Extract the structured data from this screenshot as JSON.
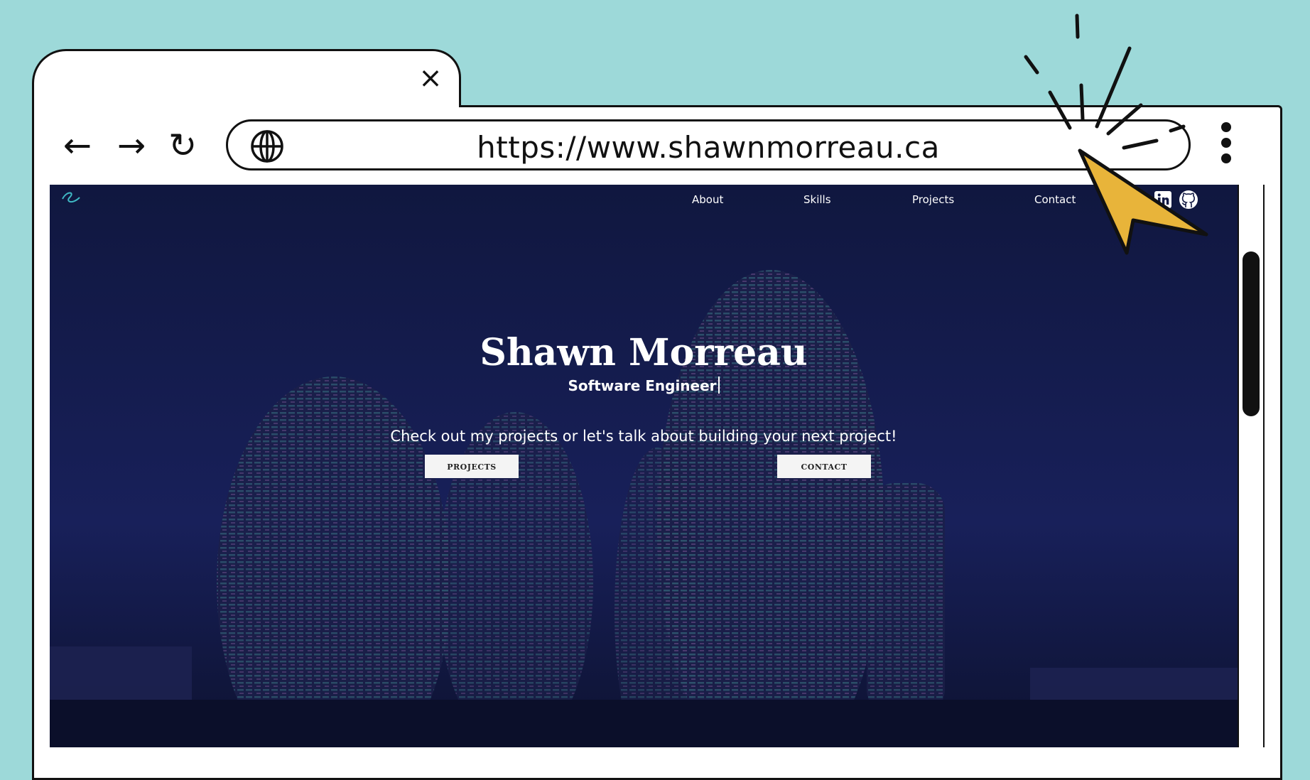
{
  "browser": {
    "tab_close_glyph": "×",
    "back_glyph": "←",
    "forward_glyph": "→",
    "reload_glyph": "↻",
    "url": "https://www.shawnmorreau.ca",
    "icons": [
      "globe-icon",
      "close-icon",
      "back-arrow-icon",
      "forward-arrow-icon",
      "reload-icon",
      "kebab-menu-icon",
      "cursor-pointer-icon"
    ]
  },
  "site": {
    "nav": {
      "about": "About",
      "skills": "Skills",
      "projects": "Projects",
      "contact": "Contact"
    },
    "social_icons": [
      "linkedin-icon",
      "github-icon"
    ],
    "hero": {
      "title": "Shawn Morreau",
      "subtitle": "Software Engineer",
      "tagline": "Check out my projects or let's talk about building your next project!",
      "projects_button": "PROJECTS",
      "contact_button": "CONTACT"
    }
  },
  "colors": {
    "background": "#9dd9d9",
    "hero_bg": "#131a44",
    "cursor_fill": "#e8b43a",
    "outline": "#111111"
  }
}
